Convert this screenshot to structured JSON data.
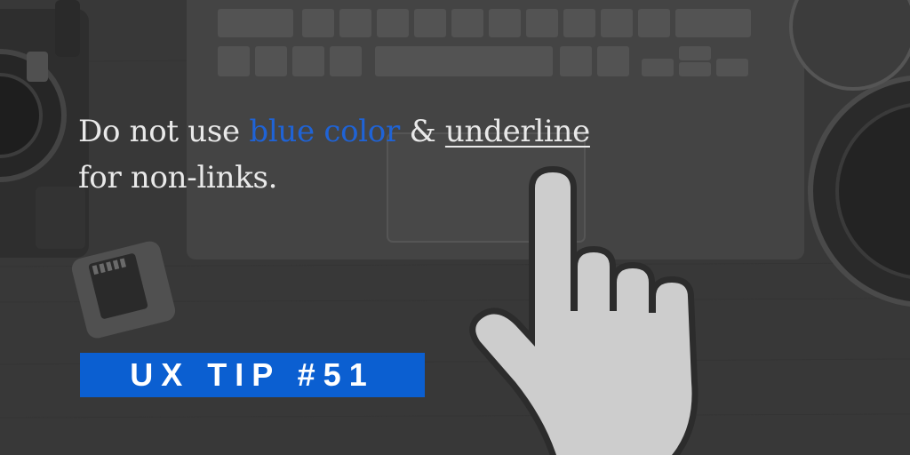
{
  "headline": {
    "part1": "Do not use ",
    "blue_text": "blue color",
    "part2": " & ",
    "underline_text": "underline",
    "line2": "for non-links."
  },
  "badge": {
    "label": "UX TIP #51"
  },
  "colors": {
    "accent_blue": "#0b5fd1",
    "link_blue": "#1f63d6",
    "text": "#e9e9e9",
    "background": "#3a3a3a"
  },
  "icons": [
    "camera-icon",
    "laptop-keyboard-icon",
    "sd-card-icon",
    "lens-icon",
    "pointer-hand-icon"
  ]
}
